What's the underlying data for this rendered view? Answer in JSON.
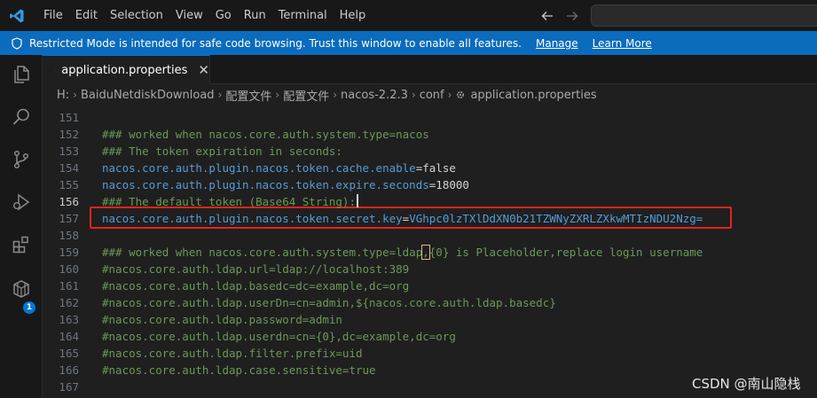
{
  "menu": [
    "File",
    "Edit",
    "Selection",
    "View",
    "Go",
    "Run",
    "Terminal",
    "Help"
  ],
  "banner": {
    "message": "Restricted Mode is intended for safe code browsing. Trust this window to enable all features.",
    "manage": "Manage",
    "learn_more": "Learn More",
    "color": "#0b6bbd"
  },
  "activity": {
    "icons": [
      "files-icon",
      "search-icon",
      "source-control-icon",
      "run-debug-icon",
      "extensions-icon",
      "remote-explorer-icon"
    ],
    "extensions_badge": "1"
  },
  "tab": {
    "label": "application.properties",
    "close": "✕"
  },
  "breadcrumbs": [
    "H:",
    "BaiduNetdiskDownload",
    "配置文件",
    "配置文件",
    "nacos-2.2.3",
    "conf",
    "application.properties"
  ],
  "editor": {
    "lines": [
      {
        "num": "151",
        "segs": []
      },
      {
        "num": "152",
        "segs": [
          {
            "t": "### worked when nacos.core.auth.system.type=nacos",
            "c": "comment"
          }
        ]
      },
      {
        "num": "153",
        "segs": [
          {
            "t": "### The token expiration in seconds:",
            "c": "comment"
          }
        ]
      },
      {
        "num": "154",
        "segs": [
          {
            "t": "nacos.core.auth.plugin.nacos.token.cache.enable",
            "c": "key"
          },
          {
            "t": "=",
            "c": "eq"
          },
          {
            "t": "false",
            "c": "val"
          }
        ]
      },
      {
        "num": "155",
        "segs": [
          {
            "t": "nacos.core.auth.plugin.nacos.token.expire.seconds",
            "c": "key"
          },
          {
            "t": "=",
            "c": "eq"
          },
          {
            "t": "18000",
            "c": "val"
          }
        ]
      },
      {
        "num": "156",
        "segs": [
          {
            "t": "### The default token (Base64 String):",
            "c": "comment"
          }
        ],
        "cursor": true,
        "active": true
      },
      {
        "num": "157",
        "segs": [
          {
            "t": "nacos.core.auth.plugin.nacos.token.secret.key",
            "c": "key"
          },
          {
            "t": "=",
            "c": "eq"
          },
          {
            "t": "VGhpc0lzTXlDdXN0b21TZWNyZXRLZXkwMTIzNDU2Nzg=",
            "c": "valblue"
          }
        ]
      },
      {
        "num": "158",
        "segs": []
      },
      {
        "num": "159",
        "segs": [
          {
            "t": "### worked when nacos.core.auth.system.type=ldap",
            "c": "comment"
          },
          {
            "t": ",",
            "c": "bracket"
          },
          {
            "t": "{0} is Placeholder,replace login username",
            "c": "comment"
          }
        ]
      },
      {
        "num": "160",
        "segs": [
          {
            "t": "#nacos.core.auth.ldap.url=ldap://localhost:389",
            "c": "comment"
          }
        ]
      },
      {
        "num": "161",
        "segs": [
          {
            "t": "#nacos.core.auth.ldap.basedc=dc=example,dc=org",
            "c": "comment"
          }
        ]
      },
      {
        "num": "162",
        "segs": [
          {
            "t": "#nacos.core.auth.ldap.userDn=cn=admin,${nacos.core.auth.ldap.basedc}",
            "c": "comment"
          }
        ]
      },
      {
        "num": "163",
        "segs": [
          {
            "t": "#nacos.core.auth.ldap.password=admin",
            "c": "comment"
          }
        ]
      },
      {
        "num": "164",
        "segs": [
          {
            "t": "#nacos.core.auth.ldap.userdn=cn={0},dc=example,dc=org",
            "c": "comment"
          }
        ]
      },
      {
        "num": "165",
        "segs": [
          {
            "t": "#nacos.core.auth.ldap.filter.prefix=uid",
            "c": "comment"
          }
        ]
      },
      {
        "num": "166",
        "segs": [
          {
            "t": "#nacos.core.auth.ldap.case.sensitive=true",
            "c": "comment"
          }
        ]
      },
      {
        "num": "167",
        "segs": []
      }
    ]
  },
  "watermark": "CSDN @南山隐栈"
}
